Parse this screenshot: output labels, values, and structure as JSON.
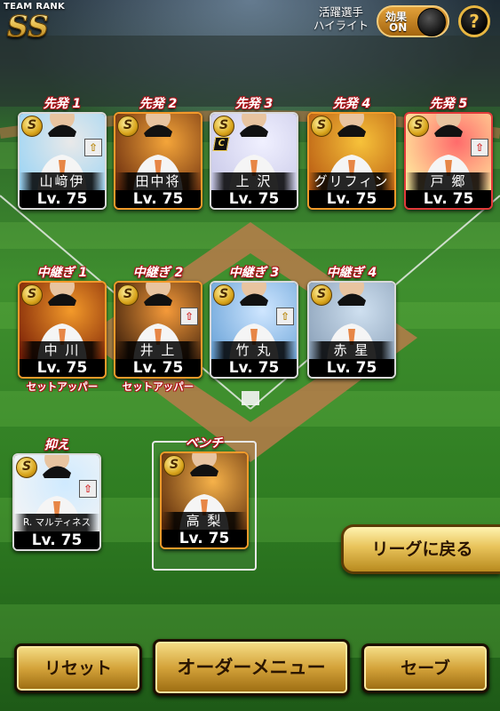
{
  "header": {
    "team_rank_label": "TEAM RANK",
    "team_rank_value": "SS",
    "highlight_label_line1": "活躍選手",
    "highlight_label_line2": "ハイライト",
    "effect_toggle_title": "効果",
    "effect_toggle_state": "ON",
    "help_label": "?"
  },
  "starters": [
    {
      "position": "先発 1",
      "name": "山﨑伊",
      "level": "Lv. 75",
      "badge": "S",
      "upgrade": "gold"
    },
    {
      "position": "先発 2",
      "name": "田中将",
      "level": "Lv. 75",
      "badge": "S",
      "upgrade": ""
    },
    {
      "position": "先発 3",
      "name": "上 沢",
      "level": "Lv. 75",
      "badge": "S",
      "captain": "C",
      "upgrade": ""
    },
    {
      "position": "先発 4",
      "name": "グリフィン",
      "level": "Lv. 75",
      "badge": "S",
      "upgrade": ""
    },
    {
      "position": "先発 5",
      "name": "戸 郷",
      "level": "Lv. 75",
      "badge": "S",
      "upgrade": "red"
    }
  ],
  "relievers": [
    {
      "position": "中継ぎ 1",
      "name": "中 川",
      "level": "Lv. 75",
      "badge": "S",
      "sub": "セットアッパー"
    },
    {
      "position": "中継ぎ 2",
      "name": "井 上",
      "level": "Lv. 75",
      "badge": "S",
      "sub": "セットアッパー",
      "upgrade": "red"
    },
    {
      "position": "中継ぎ 3",
      "name": "竹 丸",
      "level": "Lv. 75",
      "badge": "S",
      "upgrade": "gold"
    },
    {
      "position": "中継ぎ 4",
      "name": "赤 星",
      "level": "Lv. 75",
      "badge": "S"
    }
  ],
  "closer": {
    "position": "抑え",
    "name": "R. マルティネス",
    "level": "Lv. 75",
    "badge": "S",
    "upgrade": "red"
  },
  "bench": {
    "position": "ベンチ",
    "name": "高 梨",
    "level": "Lv. 75",
    "badge": "S"
  },
  "buttons": {
    "league_back": "リーグに戻る",
    "reset": "リセット",
    "order_menu": "オーダーメニュー",
    "save": "セーブ"
  },
  "colors": {
    "accent_gold": "#e8c35a",
    "label_red": "#b0131a"
  }
}
